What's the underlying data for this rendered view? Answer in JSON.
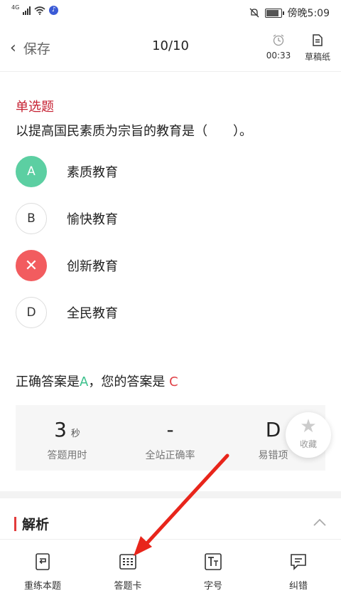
{
  "status_bar": {
    "network": "4G",
    "time": "傍晚5:09"
  },
  "header": {
    "back_label": "保存",
    "progress": "10/10",
    "timer": "00:33",
    "draft_label": "草稿纸"
  },
  "question": {
    "type": "单选题",
    "text": "以提高国民素质为宗旨的教育是（　　）。",
    "options": [
      {
        "letter": "A",
        "text": "素质教育",
        "state": "correct"
      },
      {
        "letter": "B",
        "text": "愉快教育",
        "state": "normal"
      },
      {
        "letter": "C",
        "text": "创新教育",
        "state": "wrong"
      },
      {
        "letter": "D",
        "text": "全民教育",
        "state": "normal"
      }
    ]
  },
  "answer": {
    "prefix": "正确答案是",
    "correct": "A",
    "middle": "，您的答案是 ",
    "user": "C"
  },
  "stats": [
    {
      "value": "3",
      "unit": "秒",
      "label": "答题用时"
    },
    {
      "value": "-",
      "unit": "",
      "label": "全站正确率"
    },
    {
      "value": "D",
      "unit": "",
      "label": "易错项"
    }
  ],
  "favorite_label": "收藏",
  "analysis_title": "解析",
  "bottom_tabs": [
    {
      "label": "重练本题",
      "icon": "redo-doc-icon"
    },
    {
      "label": "答题卡",
      "icon": "answer-card-icon"
    },
    {
      "label": "字号",
      "icon": "font-size-icon"
    },
    {
      "label": "纠错",
      "icon": "feedback-icon"
    }
  ],
  "colors": {
    "correct": "#5ccfa2",
    "wrong": "#f25c5f",
    "accent_red": "#c62233",
    "arrow": "#e8251b"
  }
}
